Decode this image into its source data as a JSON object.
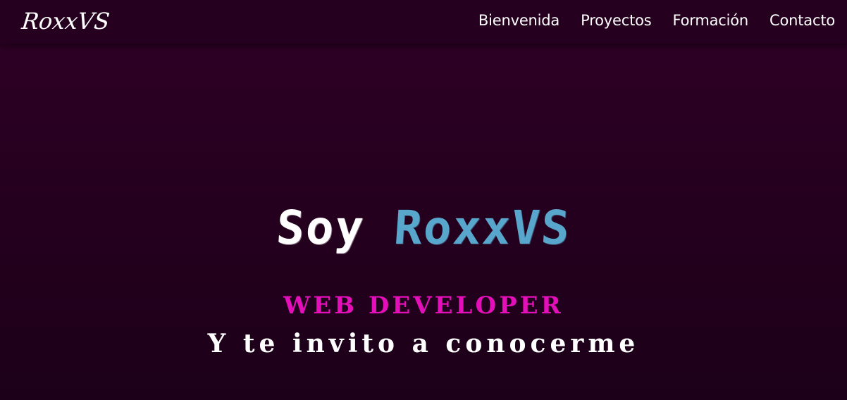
{
  "navbar": {
    "brand": "RoxxVS",
    "links": [
      "Bienvenida",
      "Proyectos",
      "Formación",
      "Contacto"
    ]
  },
  "hero": {
    "title_prefix": "Soy",
    "title_name": "RoxxVS",
    "role": "WEB DEVELOPER",
    "tagline": "Y te invito a conocerme"
  },
  "colors": {
    "background": "#26001f",
    "name_accent": "#59a6cc",
    "role_accent": "#e30fb8",
    "text": "#ffffff"
  }
}
